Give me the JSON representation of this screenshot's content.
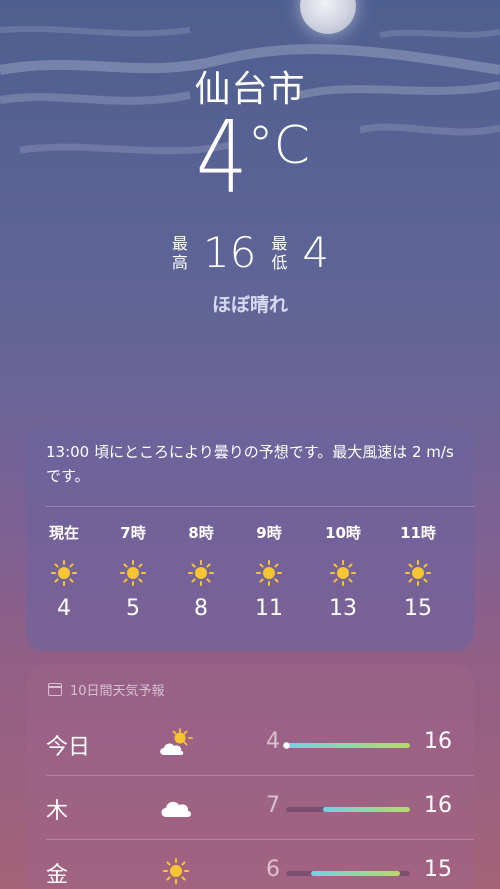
{
  "location": {
    "city": "仙台市",
    "temperature": "4",
    "unit": "°C",
    "high_label": "最高",
    "high": "16",
    "low_label": "最低",
    "low": "4",
    "condition": "ほぼ晴れ"
  },
  "hourly": {
    "summary": "13:00 頃にところにより曇りの予想です。最大風速は 2 m/s です。",
    "items": [
      {
        "time": "現在",
        "icon": "sun-icon",
        "temp": "4"
      },
      {
        "time": "7時",
        "icon": "sun-icon",
        "temp": "5"
      },
      {
        "time": "8時",
        "icon": "sun-icon",
        "temp": "8"
      },
      {
        "time": "9時",
        "icon": "sun-icon",
        "temp": "11"
      },
      {
        "time": "10時",
        "icon": "sun-icon",
        "temp": "13"
      },
      {
        "time": "11時",
        "icon": "sun-icon",
        "temp": "15"
      }
    ]
  },
  "daily": {
    "header": "10日間天気予報",
    "items": [
      {
        "day": "今日",
        "icon": "partly-cloudy-icon",
        "low": "4",
        "high": "16",
        "range_start": 0.0,
        "range_end": 1.0,
        "current": 0.0
      },
      {
        "day": "木",
        "icon": "cloud-icon",
        "low": "7",
        "high": "16",
        "range_start": 0.3,
        "range_end": 1.0
      },
      {
        "day": "金",
        "icon": "sun-icon",
        "low": "6",
        "high": "15",
        "range_start": 0.2,
        "range_end": 0.92
      }
    ]
  },
  "colors": {
    "sun": "#f7c531",
    "range_cool": "#6fd3e6",
    "range_warm": "#b8d86a"
  }
}
